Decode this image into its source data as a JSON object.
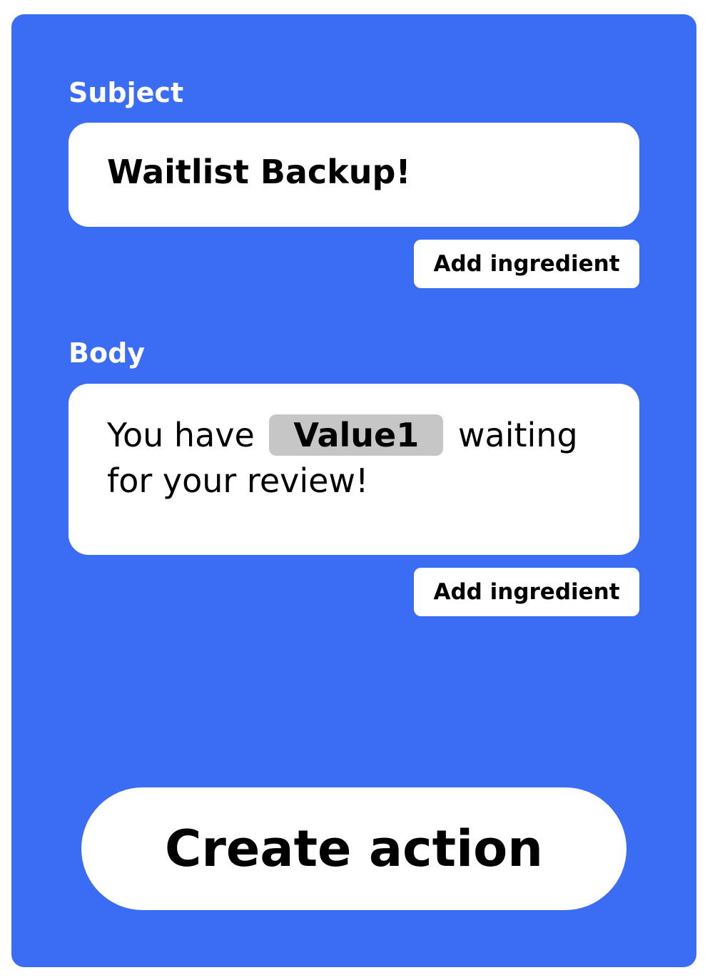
{
  "colors": {
    "panel_bg": "#3a6cf4",
    "box_bg": "#ffffff",
    "ingredient_pill_bg": "#c6c6c6",
    "text": "#000000",
    "label_text": "#ffffff"
  },
  "subject": {
    "label": "Subject",
    "value": "Waitlist Backup!",
    "add_ingredient_label": "Add ingredient"
  },
  "body": {
    "label": "Body",
    "text_before": "You have",
    "ingredient": "Value1",
    "text_after": "waiting for your review!",
    "add_ingredient_label": "Add ingredient"
  },
  "create_action": {
    "label": "Create action"
  }
}
